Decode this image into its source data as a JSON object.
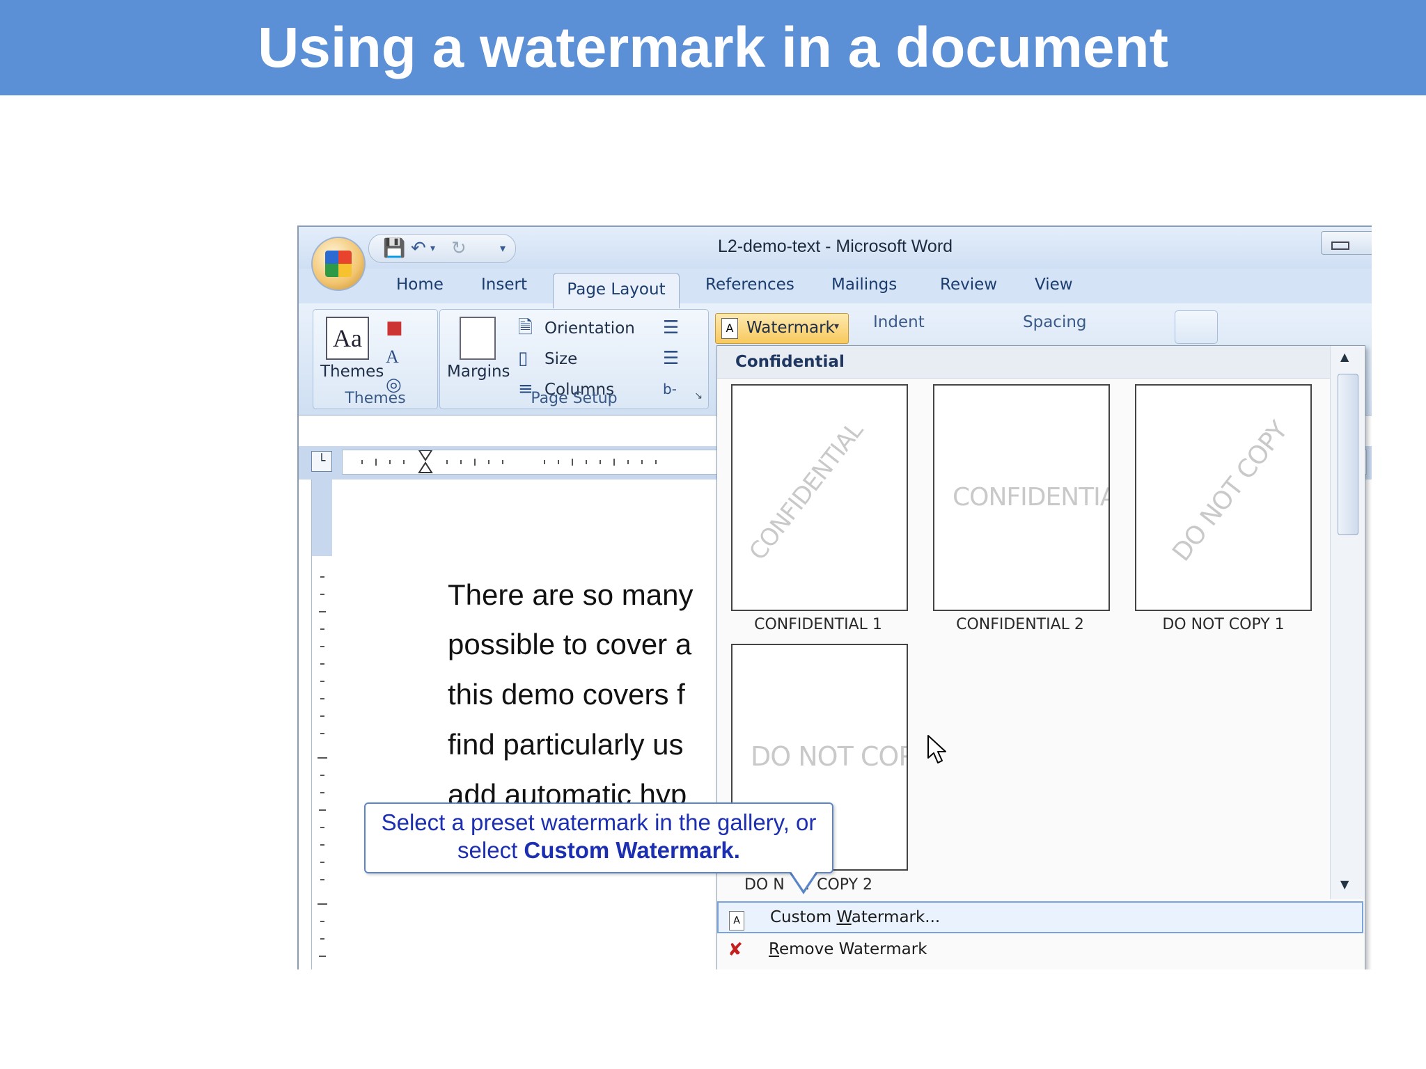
{
  "slide": {
    "title": "Using a watermark in a document"
  },
  "window": {
    "title": "L2-demo-text - Microsoft Word"
  },
  "tabs": {
    "home": "Home",
    "insert": "Insert",
    "page_layout": "Page Layout",
    "references": "References",
    "mailings": "Mailings",
    "review": "Review",
    "view": "View"
  },
  "ribbon": {
    "themes_button": "Themes",
    "themes_group": "Themes",
    "margins_button": "Margins",
    "orientation": "Orientation",
    "size": "Size",
    "columns": "Columns",
    "page_setup_group": "Page Setup",
    "watermark_button": "Watermark",
    "indent": "Indent",
    "spacing": "Spacing"
  },
  "document": {
    "lines": [
      "There are so many",
      "possible to cover a",
      "this demo covers f",
      "find particularly us",
      "add automatic hyp"
    ]
  },
  "gallery": {
    "header": "Confidential",
    "items": [
      {
        "label": "CONFIDENTIAL 1",
        "watermark": "CONFIDENTIAL"
      },
      {
        "label": "CONFIDENTIAL 2",
        "watermark": "CONFIDENTIAL"
      },
      {
        "label": "DO NOT COPY 1",
        "watermark": "DO NOT COPY"
      },
      {
        "label": "DO N",
        "label_tail": "T COPY 2",
        "watermark": "DO NOT COPY"
      }
    ],
    "menu": {
      "custom": {
        "pre": "Custom ",
        "accel": "W",
        "post": "atermark..."
      },
      "remove": {
        "accel": "R",
        "post": "emove Watermark"
      }
    }
  },
  "callout": {
    "line1": "Select a preset watermark in the gallery, or",
    "line2_pre": "select ",
    "line2_bold": "Custom Watermark."
  },
  "icons": {
    "office": "office-button-icon",
    "save": "save-icon",
    "undo": "undo-icon",
    "redo": "redo-icon"
  },
  "colors": {
    "banner": "#5b8fd6",
    "callout_text": "#1c2fb0",
    "highlight": "#f8c95c"
  }
}
